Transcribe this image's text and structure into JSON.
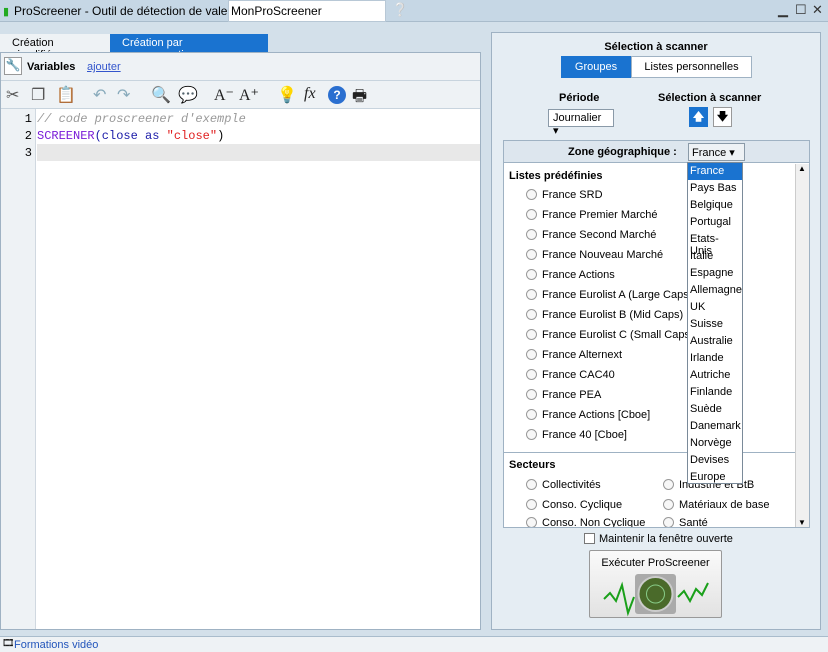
{
  "window": {
    "title": "ProScreener - Outil de détection de valeurs",
    "screener_name": "MonProScreener"
  },
  "tabs": [
    {
      "label": "Création simplifiée"
    },
    {
      "label": "Création par programmation"
    }
  ],
  "variables": {
    "label": "Variables",
    "add_link": "ajouter"
  },
  "editor": {
    "lines": [
      {
        "num": "1",
        "text": "// code proscreener d'exemple"
      },
      {
        "num": "2"
      },
      {
        "num": "3"
      }
    ],
    "line2": {
      "kw": "SCREENER",
      "p1": "(close ",
      "as": "as",
      "sp": " ",
      "str": "\"close\"",
      "p2": ")"
    }
  },
  "right": {
    "selection_title": "Sélection à scanner",
    "seg_groups": "Groupes",
    "seg_lists": "Listes personnelles",
    "period_label": "Période",
    "period_value": "Journalier",
    "selection_label": "Sélection à scanner",
    "zone_label": "Zone géographique :",
    "zone_value": "France",
    "predefined_title": "Listes prédéfinies",
    "predefined": [
      "France SRD",
      "France Premier Marché",
      "France Second Marché",
      "France Nouveau Marché",
      "France Actions",
      "France Eurolist A (Large Caps)",
      "France Eurolist B (Mid Caps)",
      "France Eurolist C (Small Caps)",
      "France Alternext",
      "France CAC40",
      "France PEA",
      "France Actions [Cboe]",
      "France 40 [Cboe]"
    ],
    "sectors_title": "Secteurs",
    "sectors": [
      "Collectivités",
      "Industrie et BtB",
      "Conso. Cyclique",
      "Matériaux de base",
      "Conso. Non Cyclique",
      "Santé"
    ],
    "keep_open": "Maintenir la fenêtre ouverte",
    "run_button": "Exécuter ProScreener"
  },
  "dropdown": [
    "France",
    "Pays Bas",
    "Belgique",
    "Portugal",
    "Etats-Unis",
    "Italie",
    "Espagne",
    "Allemagne",
    "UK",
    "Suisse",
    "Australie",
    "Irlande",
    "Autriche",
    "Finlande",
    "Suède",
    "Danemark",
    "Norvège",
    "Devises",
    "Europe"
  ],
  "status": {
    "video": "Formations vidéo"
  }
}
